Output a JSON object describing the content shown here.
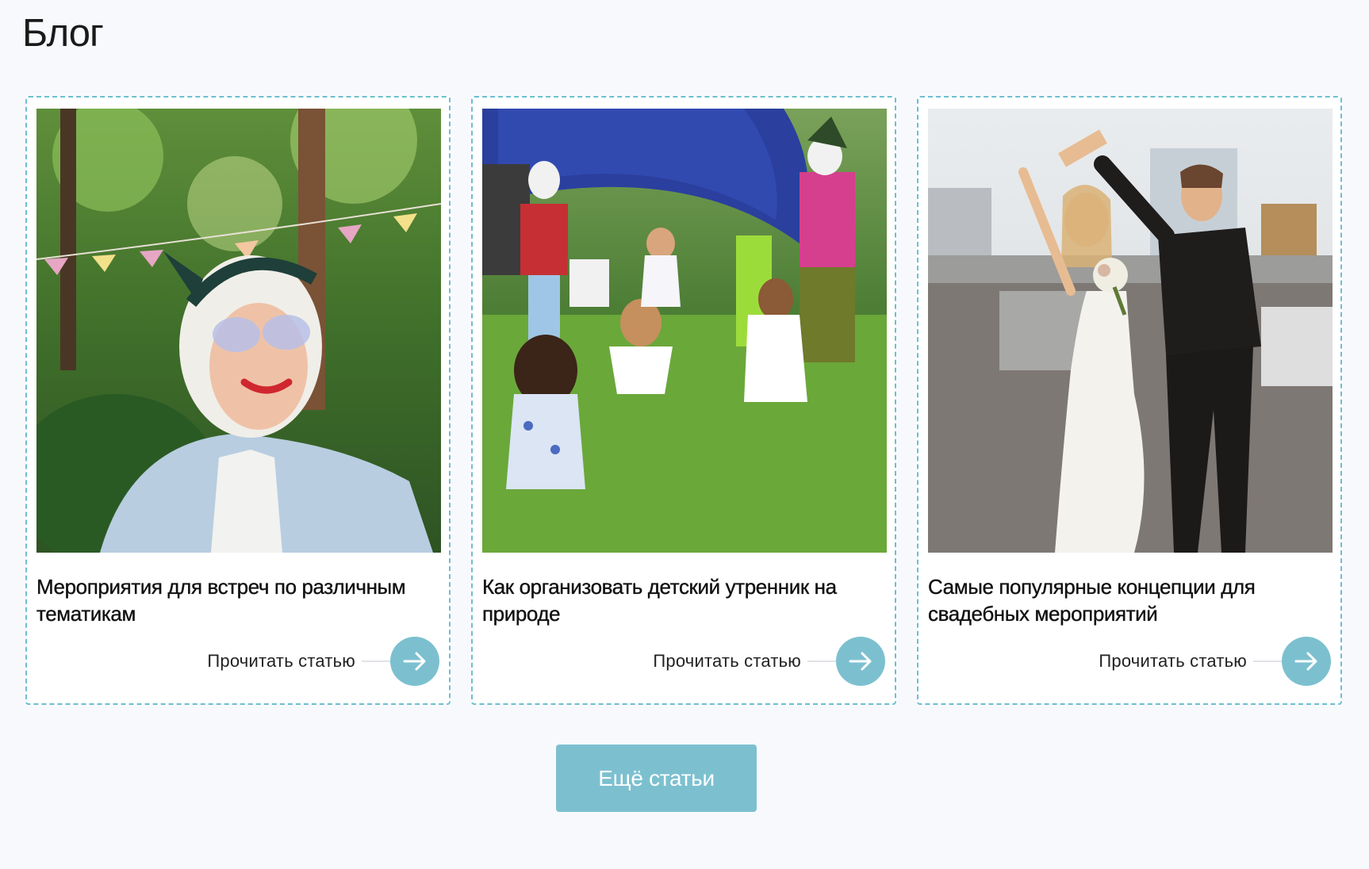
{
  "page": {
    "title": "Блог"
  },
  "colors": {
    "accent": "#7cc0d0",
    "card_border": "#6cbfd0",
    "background": "#f8f9fd"
  },
  "cards": [
    {
      "title": "Мероприятия для встреч по различным тематикам",
      "image": "photo-senior-woman-park",
      "read_label": "Прочитать статью",
      "arrow_icon": "arrow-right-icon"
    },
    {
      "title": "Как организовать детский утренник на природе",
      "image": "photo-kids-party-outdoors",
      "read_label": "Прочитать статью",
      "arrow_icon": "arrow-right-icon"
    },
    {
      "title": "Самые популярные концепции для свадебных мероприятий",
      "image": "photo-wedding-couple-rooftop",
      "read_label": "Прочитать статью",
      "arrow_icon": "arrow-right-icon"
    }
  ],
  "more_button": {
    "label": "Ещё статьи"
  }
}
